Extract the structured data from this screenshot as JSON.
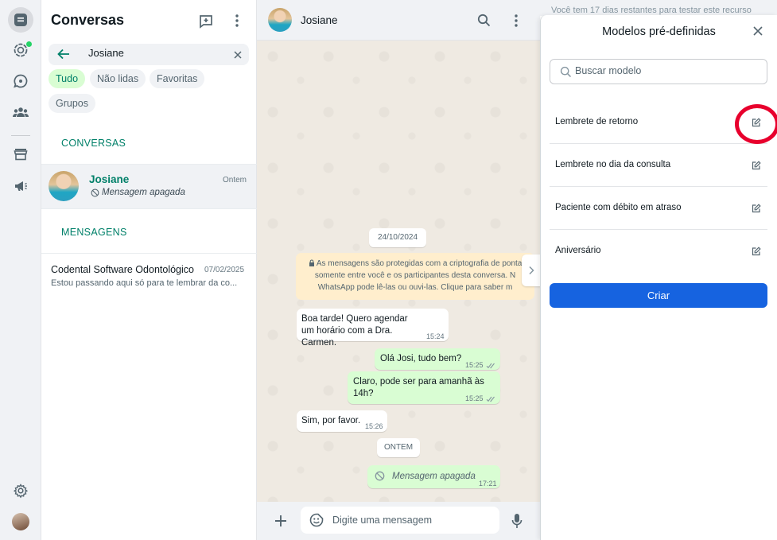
{
  "sidebar": {
    "items": [
      {
        "name": "chats",
        "icon": "chats-icon",
        "active": true
      },
      {
        "name": "status",
        "icon": "status-icon",
        "badge": true
      },
      {
        "name": "channels",
        "icon": "channels-icon"
      },
      {
        "name": "communities",
        "icon": "communities-icon"
      },
      {
        "name": "business-tools",
        "icon": "store-icon"
      },
      {
        "name": "ads",
        "icon": "megaphone-icon"
      },
      {
        "name": "settings",
        "icon": "gear-icon"
      },
      {
        "name": "profile",
        "icon": "avatar"
      }
    ]
  },
  "chatlist": {
    "title": "Conversas",
    "search": {
      "value": "Josiane"
    },
    "filters": [
      "Tudo",
      "Não lidas",
      "Favoritas",
      "Grupos"
    ],
    "active_filter": "Tudo",
    "sections": {
      "conversations": "CONVERSAS",
      "messages": "MENSAGENS"
    },
    "conversation": {
      "name": "Josiane",
      "time": "Ontem",
      "preview": "Mensagem apagada"
    },
    "message_result": {
      "name": "Codental Software Odontológico",
      "date": "07/02/2025",
      "preview": "Estou passando aqui só para te lembrar da co..."
    }
  },
  "conversation": {
    "contact": "Josiane",
    "date_label": "24/10/2024",
    "encryption_notice": [
      "As mensagens são protegidas com a criptografia de ponta",
      "somente entre você e os participantes desta conversa. N",
      "WhatsApp pode lê-las ou ouvi-las. Clique para saber m"
    ],
    "messages": [
      {
        "dir": "in",
        "text": "Boa tarde! Quero agendar um horário com a Dra. Carmen.",
        "time": "15:24"
      },
      {
        "dir": "out",
        "text": "Olá Josi, tudo bem?",
        "time": "15:25"
      },
      {
        "dir": "out",
        "text": "Claro, pode ser para amanhã às 14h?",
        "time": "15:25"
      },
      {
        "dir": "in",
        "text": "Sim, por favor.",
        "time": "15:26"
      },
      {
        "dir": "out",
        "text": "Mensagem apagada",
        "time": "17:21",
        "deleted": true
      }
    ],
    "yesterday_label": "ONTEM",
    "composer_placeholder": "Digite uma mensagem"
  },
  "panel": {
    "trial_banner": "Você tem 17 dias restantes para testar este recurso",
    "title": "Modelos pré-definidas",
    "search_placeholder": "Buscar modelo",
    "templates": [
      "Lembrete de retorno",
      "Lembrete no dia da consulta",
      "Paciente com débito em atraso",
      "Aniversário"
    ],
    "create_label": "Criar"
  },
  "colors": {
    "accent": "#008069",
    "primary_button": "#1663e0",
    "highlight": "#e8002d",
    "out_bubble": "#d9fdd3"
  }
}
